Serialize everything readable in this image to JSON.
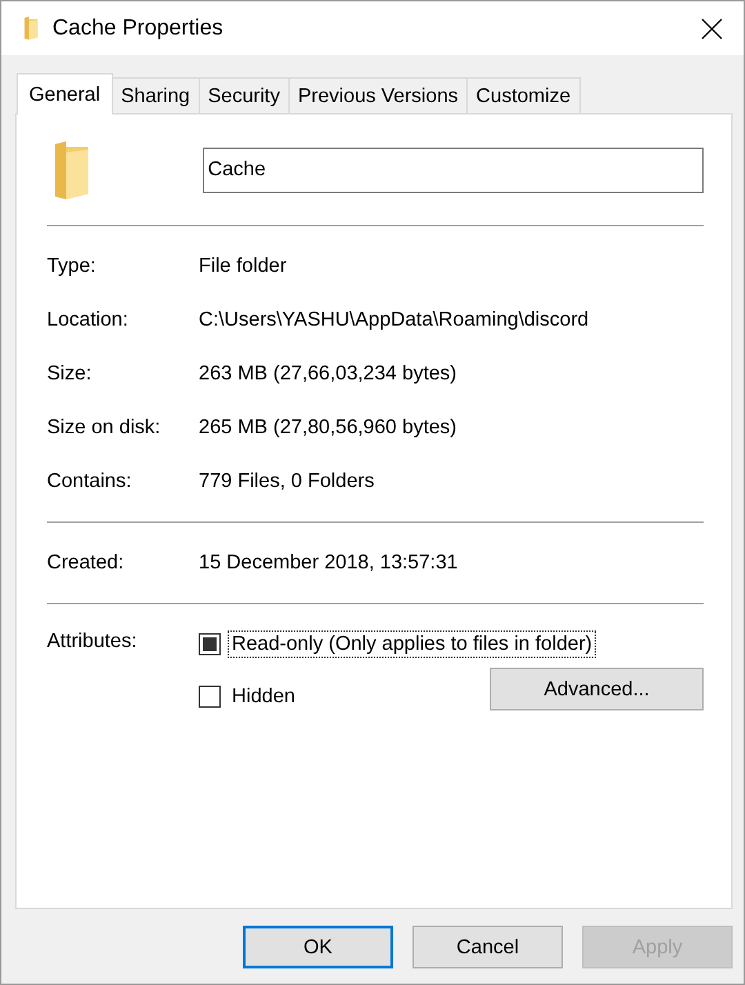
{
  "window": {
    "title": "Cache Properties"
  },
  "tabs": [
    {
      "label": "General",
      "selected": true
    },
    {
      "label": "Sharing",
      "selected": false
    },
    {
      "label": "Security",
      "selected": false
    },
    {
      "label": "Previous Versions",
      "selected": false
    },
    {
      "label": "Customize",
      "selected": false
    }
  ],
  "name_field": {
    "value": "Cache"
  },
  "sections": [
    [
      {
        "label": "Type:",
        "value": "File folder"
      },
      {
        "label": "Location:",
        "value": "C:\\Users\\YASHU\\AppData\\Roaming\\discord"
      },
      {
        "label": "Size:",
        "value": "263 MB (27,66,03,234 bytes)"
      },
      {
        "label": "Size on disk:",
        "value": "265 MB (27,80,56,960 bytes)"
      },
      {
        "label": "Contains:",
        "value": "779 Files, 0 Folders"
      }
    ],
    [
      {
        "label": "Created:",
        "value": "15 December 2018, 13:57:31"
      }
    ]
  ],
  "attributes": {
    "label": "Attributes:",
    "checkboxes": [
      {
        "label": "Read-only (Only applies to files in folder)",
        "checked": false,
        "indeterminate": true,
        "focused": true
      },
      {
        "label": "Hidden",
        "checked": false,
        "indeterminate": false,
        "focused": false
      }
    ],
    "advanced_button": "Advanced..."
  },
  "buttons": [
    {
      "label": "OK",
      "default": true,
      "disabled": false
    },
    {
      "label": "Cancel",
      "default": false,
      "disabled": false
    },
    {
      "label": "Apply",
      "default": false,
      "disabled": true
    }
  ]
}
